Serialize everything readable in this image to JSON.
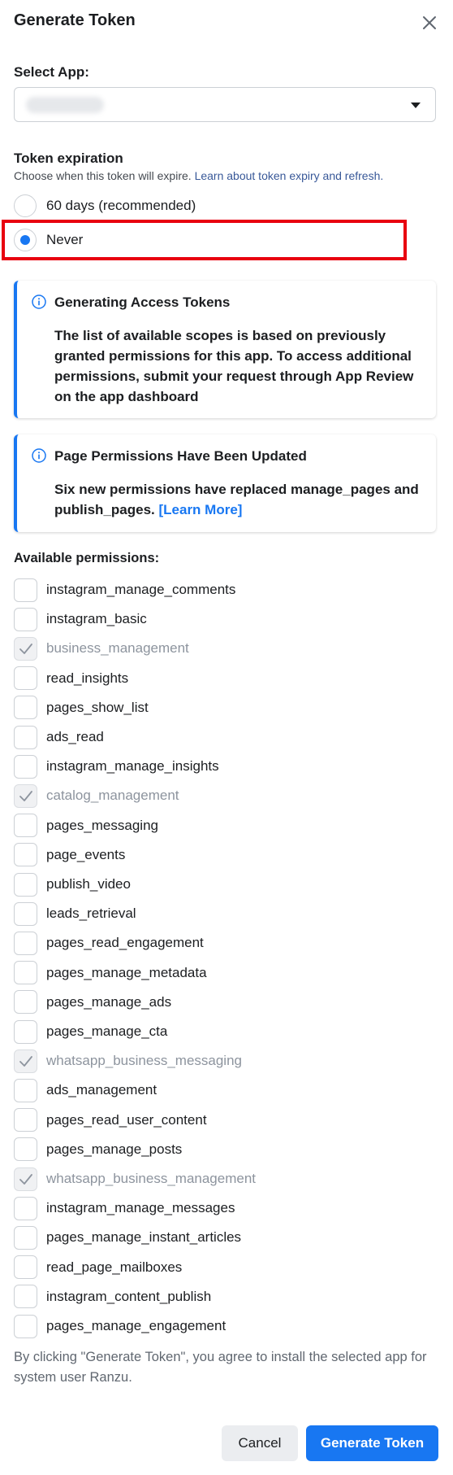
{
  "dialog": {
    "title": "Generate Token",
    "close_icon": "close-icon"
  },
  "select_app": {
    "label": "Select App:",
    "value_redacted": true
  },
  "token_expiration": {
    "label": "Token expiration",
    "description": "Choose when this token will expire.",
    "link": "Learn about token expiry and refresh.",
    "options": [
      {
        "label": "60 days (recommended)",
        "selected": false
      },
      {
        "label": "Never",
        "selected": true
      }
    ]
  },
  "notices": [
    {
      "icon": "info-icon",
      "title": "Generating Access Tokens",
      "body": "The list of available scopes is based on previously granted permissions for this app. To access additional permissions, submit your request through App Review on the app dashboard"
    },
    {
      "icon": "info-icon",
      "title": "Page Permissions Have Been Updated",
      "body": "Six new permissions have replaced manage_pages and publish_pages.",
      "link": "[Learn More]"
    }
  ],
  "permissions": {
    "label": "Available permissions:",
    "items": [
      {
        "name": "instagram_manage_comments",
        "checked": false,
        "disabled": false
      },
      {
        "name": "instagram_basic",
        "checked": false,
        "disabled": false
      },
      {
        "name": "business_management",
        "checked": true,
        "disabled": true
      },
      {
        "name": "read_insights",
        "checked": false,
        "disabled": false
      },
      {
        "name": "pages_show_list",
        "checked": false,
        "disabled": false
      },
      {
        "name": "ads_read",
        "checked": false,
        "disabled": false
      },
      {
        "name": "instagram_manage_insights",
        "checked": false,
        "disabled": false
      },
      {
        "name": "catalog_management",
        "checked": true,
        "disabled": true
      },
      {
        "name": "pages_messaging",
        "checked": false,
        "disabled": false
      },
      {
        "name": "page_events",
        "checked": false,
        "disabled": false
      },
      {
        "name": "publish_video",
        "checked": false,
        "disabled": false
      },
      {
        "name": "leads_retrieval",
        "checked": false,
        "disabled": false
      },
      {
        "name": "pages_read_engagement",
        "checked": false,
        "disabled": false
      },
      {
        "name": "pages_manage_metadata",
        "checked": false,
        "disabled": false
      },
      {
        "name": "pages_manage_ads",
        "checked": false,
        "disabled": false
      },
      {
        "name": "pages_manage_cta",
        "checked": false,
        "disabled": false
      },
      {
        "name": "whatsapp_business_messaging",
        "checked": true,
        "disabled": true
      },
      {
        "name": "ads_management",
        "checked": false,
        "disabled": false
      },
      {
        "name": "pages_read_user_content",
        "checked": false,
        "disabled": false
      },
      {
        "name": "pages_manage_posts",
        "checked": false,
        "disabled": false
      },
      {
        "name": "whatsapp_business_management",
        "checked": true,
        "disabled": true
      },
      {
        "name": "instagram_manage_messages",
        "checked": false,
        "disabled": false
      },
      {
        "name": "pages_manage_instant_articles",
        "checked": false,
        "disabled": false
      },
      {
        "name": "read_page_mailboxes",
        "checked": false,
        "disabled": false
      },
      {
        "name": "instagram_content_publish",
        "checked": false,
        "disabled": false
      },
      {
        "name": "pages_manage_engagement",
        "checked": false,
        "disabled": false
      }
    ]
  },
  "consent_text": "By clicking \"Generate Token\", you agree to install the selected app for system user Ranzu.",
  "buttons": {
    "cancel": "Cancel",
    "generate": "Generate Token"
  },
  "colors": {
    "primary": "#1877f2",
    "highlight_box": "#e8000f",
    "link": "#385898"
  }
}
